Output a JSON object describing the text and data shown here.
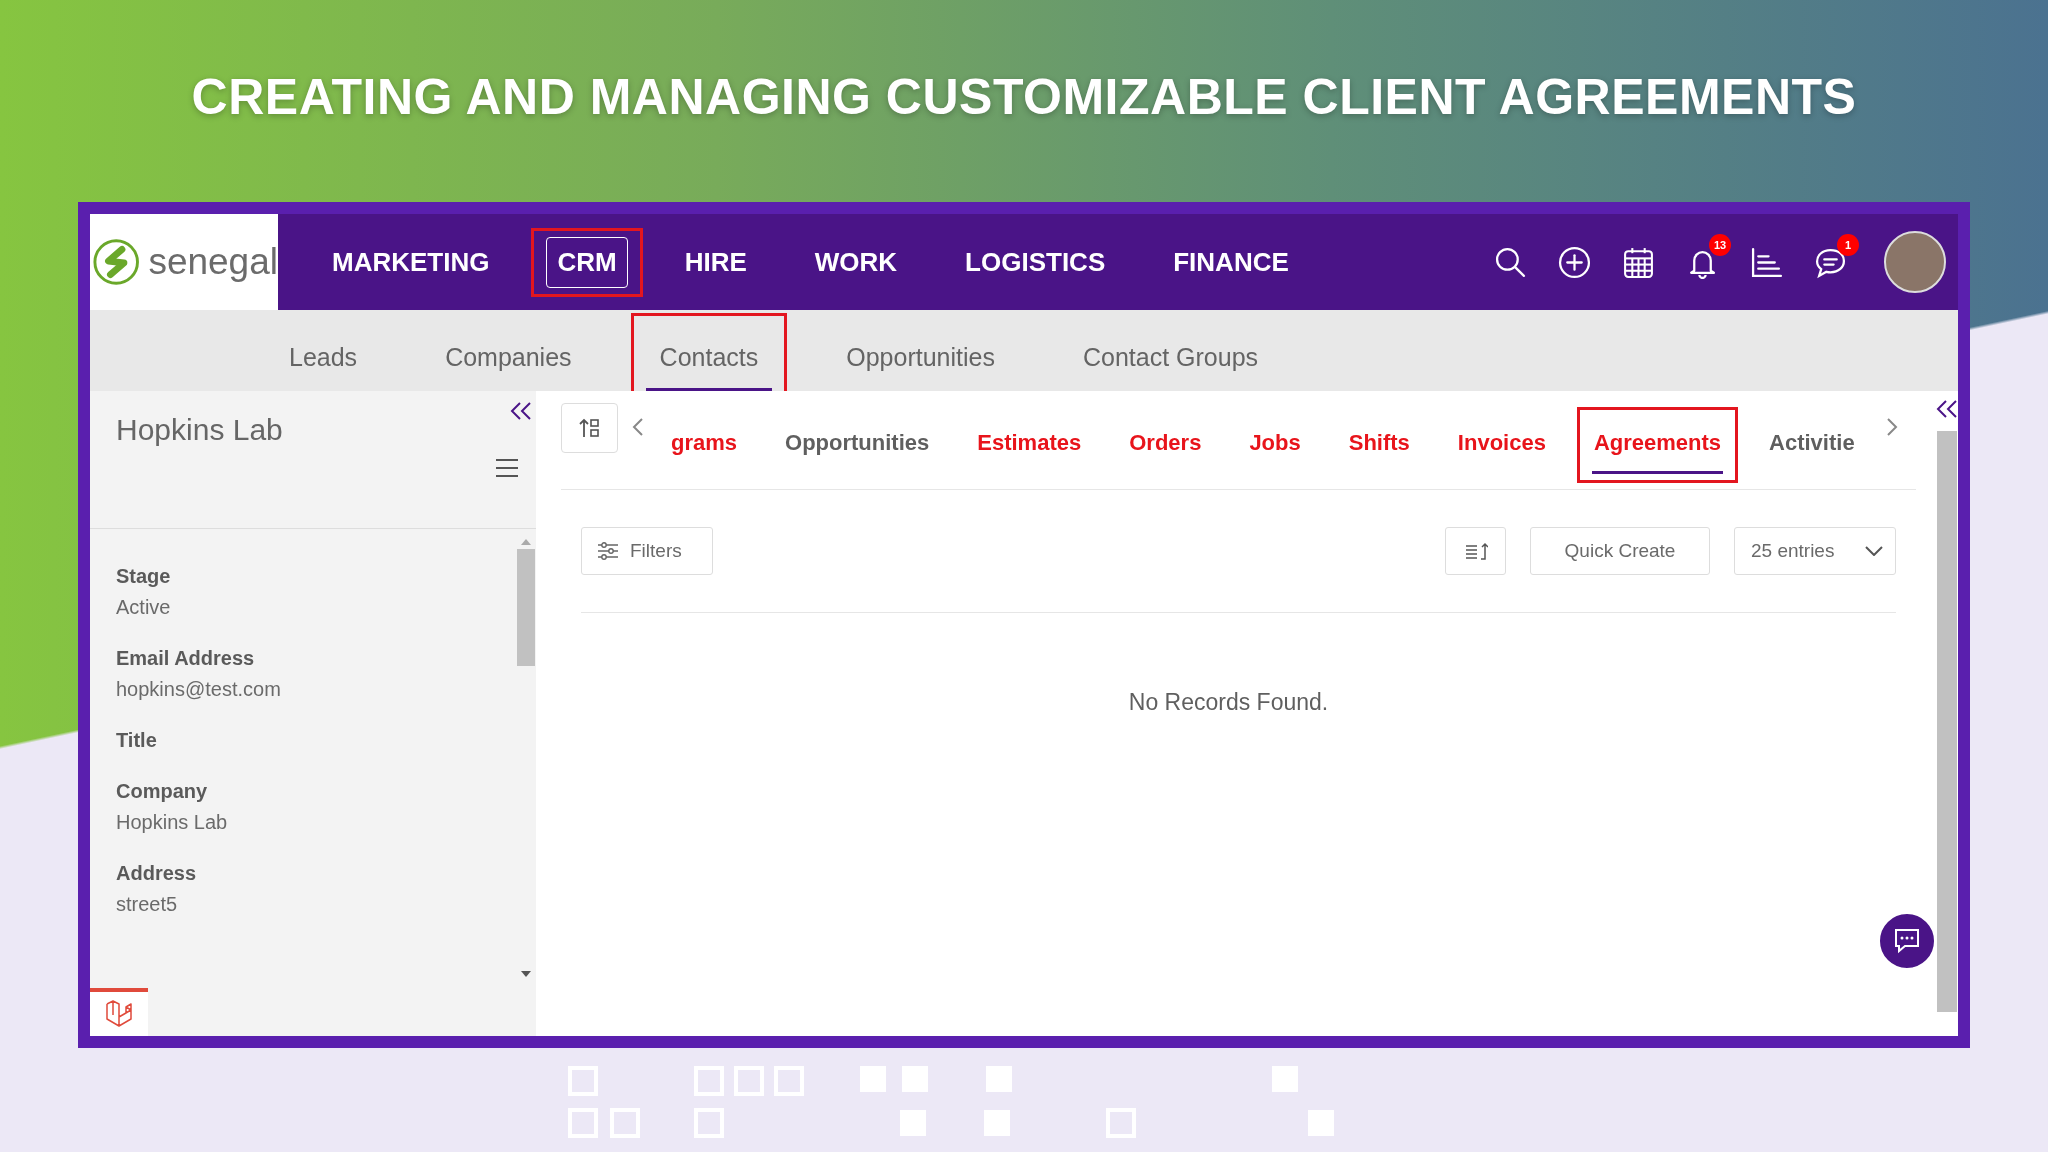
{
  "headline": "CREATING AND MANAGING CUSTOMIZABLE CLIENT AGREEMENTS",
  "app": {
    "logo": "senegal",
    "nav": [
      {
        "label": "MARKETING",
        "selected": false,
        "highlighted": false
      },
      {
        "label": "CRM",
        "selected": true,
        "highlighted": true
      },
      {
        "label": "HIRE",
        "selected": false,
        "highlighted": false
      },
      {
        "label": "WORK",
        "selected": false,
        "highlighted": false
      },
      {
        "label": "LOGISTICS",
        "selected": false,
        "highlighted": false
      },
      {
        "label": "FINANCE",
        "selected": false,
        "highlighted": false
      }
    ],
    "toolbar": [
      {
        "kind": "search"
      },
      {
        "kind": "plus"
      },
      {
        "kind": "calendar"
      },
      {
        "kind": "bell",
        "badge": "13"
      },
      {
        "kind": "chart"
      },
      {
        "kind": "chat",
        "badge": "1"
      }
    ],
    "subnav": [
      {
        "label": "Leads",
        "selected": false,
        "highlighted": false
      },
      {
        "label": "Companies",
        "selected": false,
        "highlighted": false
      },
      {
        "label": "Contacts",
        "selected": true,
        "highlighted": true
      },
      {
        "label": "Opportunities",
        "selected": false,
        "highlighted": false
      },
      {
        "label": "Contact Groups",
        "selected": false,
        "highlighted": false
      }
    ],
    "record": {
      "title": "Hopkins Lab",
      "fields": [
        {
          "label": "Stage",
          "value": "Active"
        },
        {
          "label": "Email Address",
          "value": "hopkins@test.com"
        },
        {
          "label": "Title"
        },
        {
          "label": "Company",
          "value": "Hopkins Lab"
        },
        {
          "label": "Address",
          "value": "street5"
        }
      ]
    },
    "tabs": [
      {
        "label": "grams",
        "color": "#e8141b",
        "selected": false,
        "highlighted": false
      },
      {
        "label": "Opportunities",
        "color": "#5f5f5f",
        "selected": false,
        "highlighted": false
      },
      {
        "label": "Estimates",
        "color": "#e8141b",
        "selected": false,
        "highlighted": false
      },
      {
        "label": "Orders",
        "color": "#e8141b",
        "selected": false,
        "highlighted": false
      },
      {
        "label": "Jobs",
        "color": "#e8141b",
        "selected": false,
        "highlighted": false
      },
      {
        "label": "Shifts",
        "color": "#e8141b",
        "selected": false,
        "highlighted": false
      },
      {
        "label": "Invoices",
        "color": "#e8141b",
        "selected": false,
        "highlighted": false
      },
      {
        "label": "Agreements",
        "color": "#e8141b",
        "selected": true,
        "highlighted": true
      },
      {
        "label": "Activitie",
        "color": "#5f5f5f",
        "selected": false,
        "highlighted": false
      }
    ],
    "filters_button": "Filters",
    "quick_create": "Quick Create",
    "entries": "25 entries",
    "empty_message": "No Records Found."
  }
}
